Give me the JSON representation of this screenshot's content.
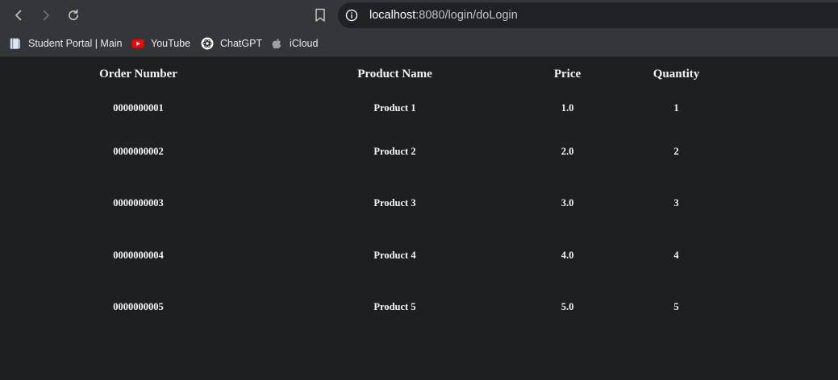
{
  "browser": {
    "url_host": "localhost",
    "url_path": ":8080/login/doLogin",
    "icons": {
      "back": "back-arrow-icon",
      "forward": "forward-arrow-icon",
      "reload": "reload-icon",
      "bookmark": "bookmark-icon",
      "site_info": "info-icon"
    },
    "colors": {
      "toolbar": "#35363a",
      "omnibox": "#202124",
      "page_bg": "#1e1f21",
      "youtube_red": "#ff0000"
    }
  },
  "bookmarks": [
    {
      "label": "Student Portal | Main",
      "icon": "book-icon"
    },
    {
      "label": "YouTube",
      "icon": "youtube-icon"
    },
    {
      "label": "ChatGPT",
      "icon": "chatgpt-icon"
    },
    {
      "label": "iCloud",
      "icon": "apple-icon"
    }
  ],
  "table": {
    "headers": [
      "Order Number",
      "Product Name",
      "Price",
      "Quantity"
    ],
    "rows": [
      {
        "order_number": "0000000001",
        "product_name": "Product 1",
        "price": "1.0",
        "quantity": "1"
      },
      {
        "order_number": "0000000002",
        "product_name": "Product 2",
        "price": "2.0",
        "quantity": "2"
      },
      {
        "order_number": "0000000003",
        "product_name": "Product 3",
        "price": "3.0",
        "quantity": "3"
      },
      {
        "order_number": "0000000004",
        "product_name": "Product 4",
        "price": "4.0",
        "quantity": "4"
      },
      {
        "order_number": "0000000005",
        "product_name": "Product 5",
        "price": "5.0",
        "quantity": "5"
      }
    ]
  }
}
